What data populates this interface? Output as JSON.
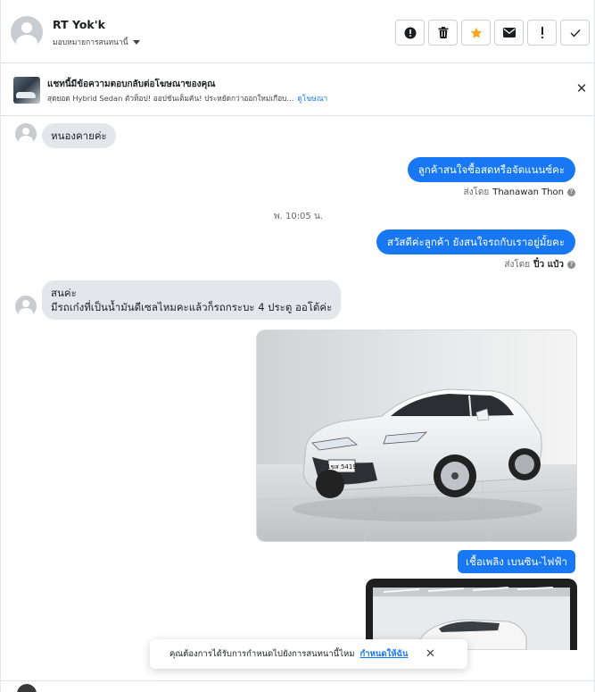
{
  "header": {
    "contact_name": "RT Yok'k",
    "assign_label": "มอบหมายการสนทนานี้",
    "actions": [
      {
        "name": "spam-button",
        "icon": "alert-circle-icon",
        "glyph": "●"
      },
      {
        "name": "delete-button",
        "icon": "trash-icon",
        "glyph": "🗑"
      },
      {
        "name": "star-button",
        "icon": "star-icon",
        "glyph": "★"
      },
      {
        "name": "mark-unread-button",
        "icon": "envelope-icon",
        "glyph": "✉"
      },
      {
        "name": "follow-up-button",
        "icon": "exclamation-icon",
        "glyph": "!"
      },
      {
        "name": "done-button",
        "icon": "check-icon",
        "glyph": "✓"
      }
    ]
  },
  "ad": {
    "title": "แชทนี้มีข้อความตอบกลับต่อโฆษณาของคุณ",
    "subtitle": "สุดยอด Hybrid Sedan ตัวท็อป! ออปชันเต็มคัน! ประหยัดกว่าออกใหม่เกือบ...",
    "link": "ดูโฆษณา"
  },
  "messages": {
    "m1": "หนองคายค่ะ",
    "m2": "ลูกค้าสนใจซื้อสดหรือจัดแนนซ์คะ",
    "m2_sentby_prefix": "ส่งโดย",
    "m2_sentby_name": "Thanawan Thon",
    "time": "พ. 10:05 น.",
    "m3": "สวัสดีค่ะลูกค้า ยังสนใจรถกับเราอยู่มั้ยคะ",
    "m3_sentby_prefix": "ส่งโดย",
    "m3_sentby_name": "ปิ๋ว แป๋ว",
    "m4_line1": "สนค่ะ",
    "m4_line2": "มีรถเก๋งที่เป็นน้ำมันดีเซลไหมคะแล้วก็รถกระบะ 4 ประตู ออโต้ค่ะ",
    "m5": "เชื้อเพลิง เบนซิน-ไฟฟ้า",
    "plate": "1ขส 5419"
  },
  "toast": {
    "text": "คุณต้องการได้รับการกำหนดไปยังการสนทนานี้ไหม",
    "link": "กำหนดให้ฉัน"
  },
  "colors": {
    "accent": "#1877f2",
    "incoming_bubble": "#e4e6eb",
    "star": "#f5a623"
  }
}
